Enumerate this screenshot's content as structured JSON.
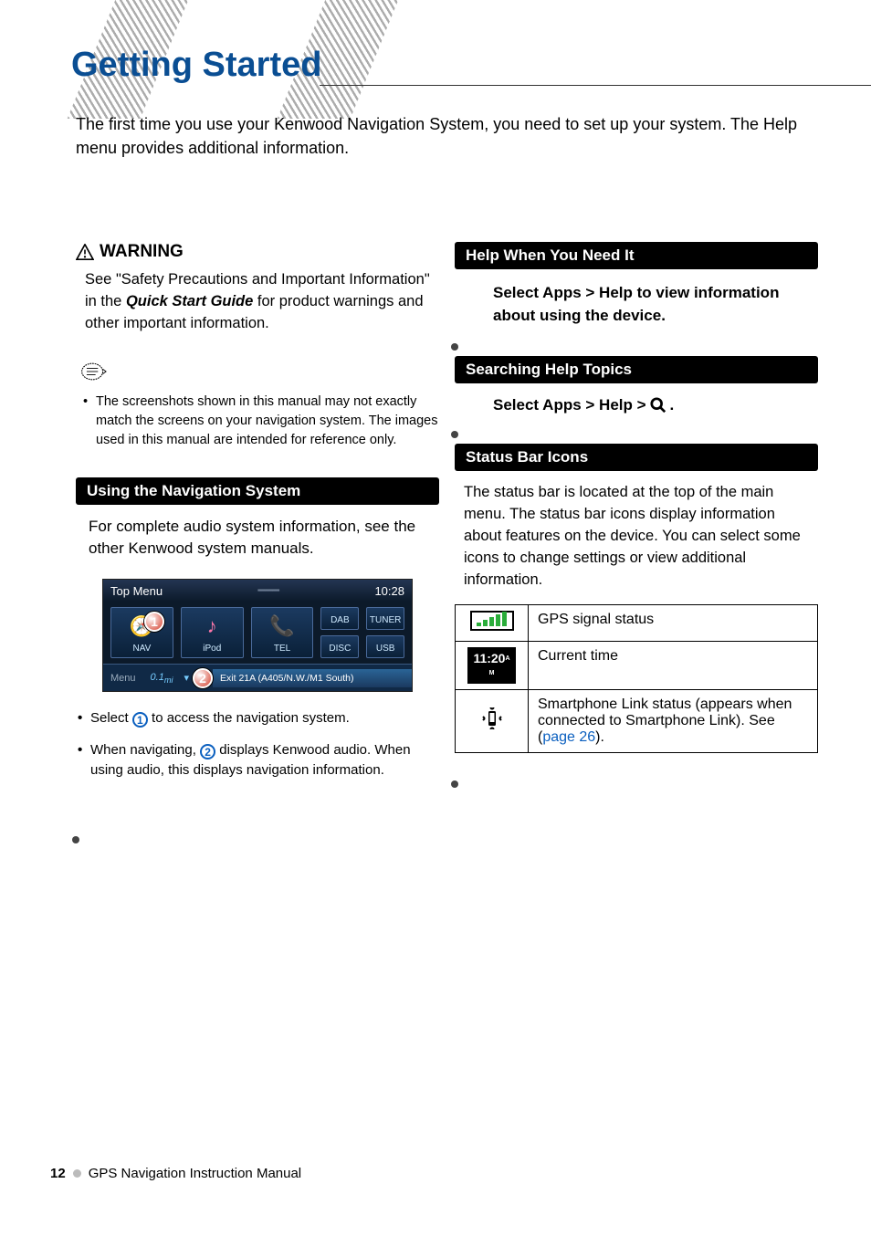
{
  "page": {
    "title": "Getting Started",
    "intro": "The first time you use your Kenwood Navigation System, you need to set up your system. The Help menu provides additional information."
  },
  "warning": {
    "heading": "WARNING",
    "line1": "See \"Safety Precautions and Important Information\" in the ",
    "em": "Quick Start Guide",
    "line2": " for product warnings and other important information."
  },
  "note": {
    "text": "The screenshots shown in this manual may not exactly match the screens on your navigation system. The images used in this manual are intended for reference only."
  },
  "sections": {
    "using_nav": {
      "title": "Using the Navigation System",
      "body": "For complete audio system information, see the other Kenwood system manuals."
    },
    "help_when": {
      "title": "Help When You Need It",
      "body": "Select Apps > Help to view information about using the device."
    },
    "searching": {
      "title": "Searching Help Topics",
      "prefix": "Select Apps > Help > ",
      "suffix": "."
    },
    "status_icons": {
      "title": "Status Bar Icons",
      "body": "The status bar is located at the top of the main menu. The status bar icons display information about features on the device. You can select some icons to change settings or view additional information.",
      "rows": {
        "signal": "GPS signal status",
        "time_icon": "11:20",
        "time_desc": "Current time",
        "link_a": "Smartphone Link status (appears when connected to Smartphone Link). See (",
        "link_page": "page 26",
        "link_b": ")."
      }
    }
  },
  "screenshot": {
    "top_menu": "Top Menu",
    "clock": "10:28",
    "tiles": {
      "nav": "NAV",
      "ipod": "iPod",
      "tel": "TEL",
      "dab": "DAB",
      "tuner": "TUNER",
      "disc": "DISC",
      "usb": "USB"
    },
    "bottom": {
      "menu": "Menu",
      "dist": "0.1",
      "unit": "mi",
      "exit": "Exit 21A (A405/N.W./M1 South)"
    }
  },
  "bullets": {
    "b1a": "Select ",
    "b1b": " to access the navigation system.",
    "b2a": "When navigating, ",
    "b2b": " displays Kenwood audio. When using audio, this displays navigation information."
  },
  "callouts": {
    "one": "1",
    "two": "2"
  },
  "footer": {
    "page": "12",
    "text": "GPS Navigation Instruction Manual"
  }
}
